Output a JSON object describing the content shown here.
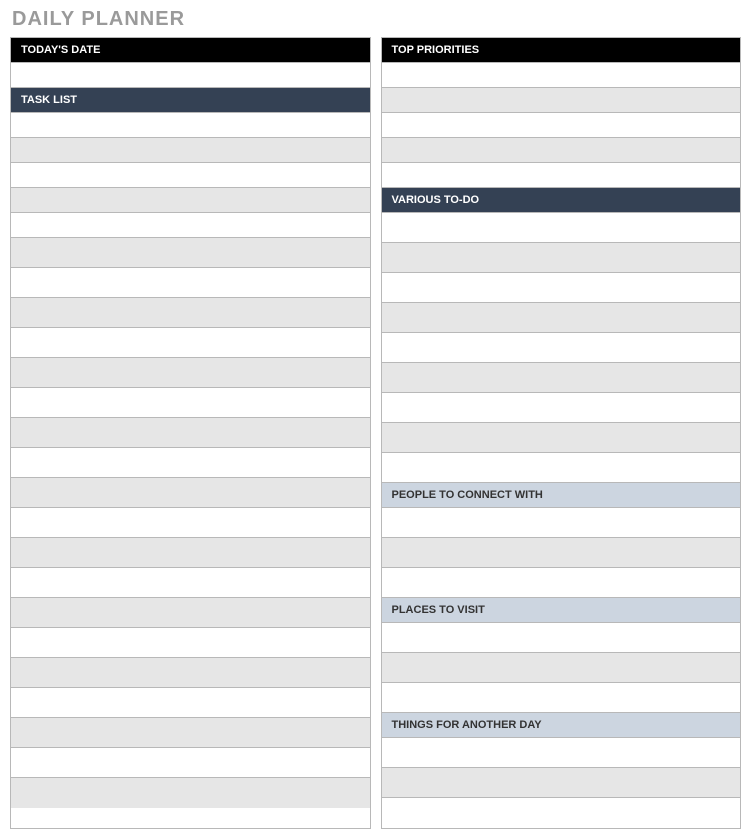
{
  "title": "DAILY PLANNER",
  "left": {
    "todays_date_label": "TODAY'S DATE",
    "task_list_label": "TASK LIST"
  },
  "right": {
    "top_priorities_label": "TOP PRIORITIES",
    "various_todo_label": "VARIOUS TO-DO",
    "people_to_connect_label": "PEOPLE TO CONNECT WITH",
    "places_to_visit_label": "PLACES TO VISIT",
    "things_another_day_label": "THINGS FOR ANOTHER DAY"
  }
}
